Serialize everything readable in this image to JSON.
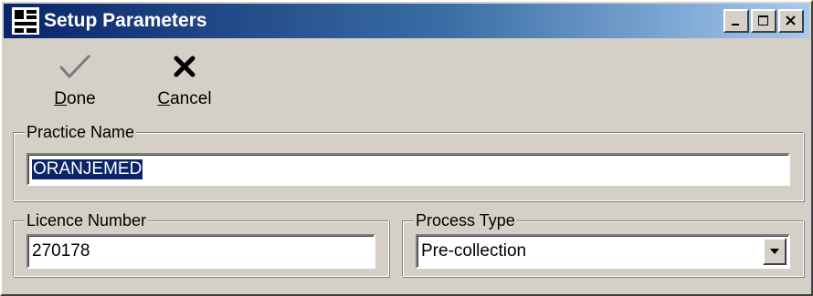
{
  "window": {
    "title": "Setup Parameters",
    "app_icon": "app-icon",
    "controls": {
      "minimize": "minimize-icon",
      "maximize": "maximize-icon",
      "close": "close-icon"
    }
  },
  "toolbar": {
    "done": {
      "hotkey": "D",
      "rest": "one",
      "icon": "checkmark-icon"
    },
    "cancel": {
      "hotkey": "C",
      "rest": "ancel",
      "icon": "x-icon"
    }
  },
  "practice": {
    "legend": "Practice Name",
    "value": "ORANJEMED"
  },
  "licence": {
    "legend": "Licence Number",
    "value": "270178"
  },
  "process": {
    "legend": "Process Type",
    "value": "Pre-collection"
  },
  "colors": {
    "face": "#d4d0c8",
    "title_start": "#0a246a",
    "title_end": "#a6caf0",
    "selection": "#0a246a"
  }
}
